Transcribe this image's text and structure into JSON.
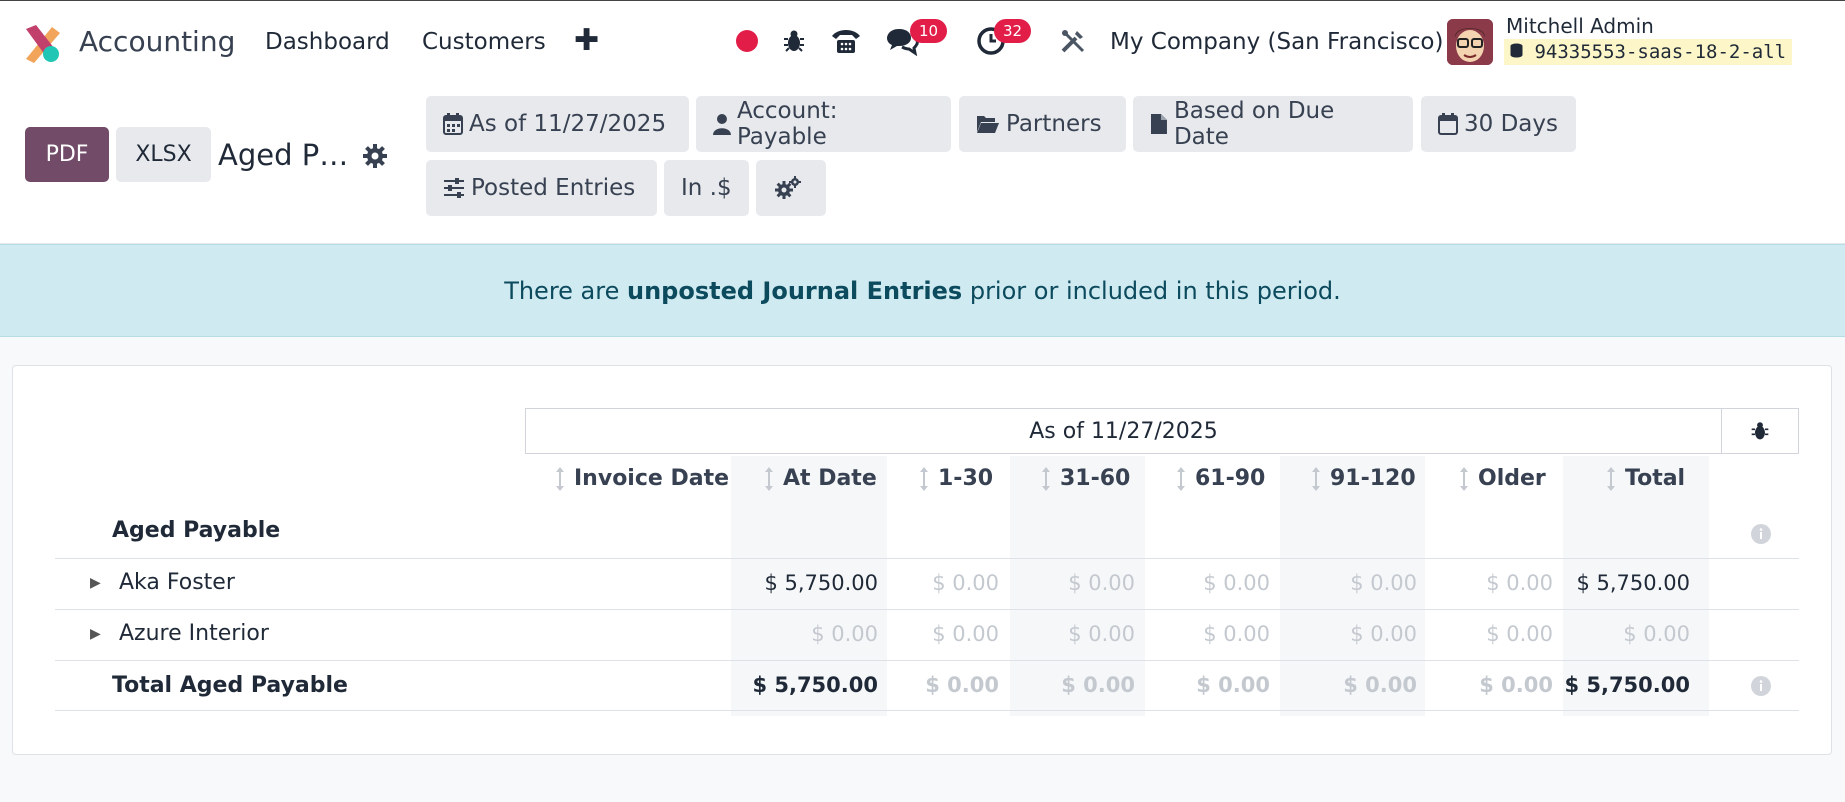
{
  "topbar": {
    "app_name": "Accounting",
    "nav": [
      "Dashboard",
      "Customers"
    ],
    "messages_badge": "10",
    "activities_badge": "32",
    "company": "My Company (San Francisco)",
    "user_name": "Mitchell Admin",
    "database": "94335553-saas-18-2-all"
  },
  "control": {
    "pdf_label": "PDF",
    "xlsx_label": "XLSX",
    "report_title": "Aged P…",
    "filters": {
      "date": "As of 11/27/2025",
      "account": "Account: Payable",
      "partners": "Partners",
      "based_on": "Based on Due Date",
      "interval": "30 Days",
      "posted": "Posted Entries",
      "currency": "In .$"
    }
  },
  "alert": {
    "prefix": "There are ",
    "bold": "unposted Journal Entries",
    "suffix": " prior or included in this period."
  },
  "report": {
    "period_header": "As of 11/27/2025",
    "columns": [
      "Invoice Date",
      "At Date",
      "1-30",
      "31-60",
      "61-90",
      "91-120",
      "Older",
      "Total"
    ],
    "section": "Aged Payable",
    "rows": [
      {
        "name": "Aka Foster",
        "values": [
          "$ 5,750.00",
          "$ 0.00",
          "$ 0.00",
          "$ 0.00",
          "$ 0.00",
          "$ 0.00",
          "$ 5,750.00"
        ]
      },
      {
        "name": "Azure Interior",
        "values": [
          "$ 0.00",
          "$ 0.00",
          "$ 0.00",
          "$ 0.00",
          "$ 0.00",
          "$ 0.00",
          "$ 0.00"
        ]
      }
    ],
    "total_label": "Total Aged Payable",
    "totals": [
      "$ 5,750.00",
      "$ 0.00",
      "$ 0.00",
      "$ 0.00",
      "$ 0.00",
      "$ 0.00",
      "$ 5,750.00"
    ]
  }
}
